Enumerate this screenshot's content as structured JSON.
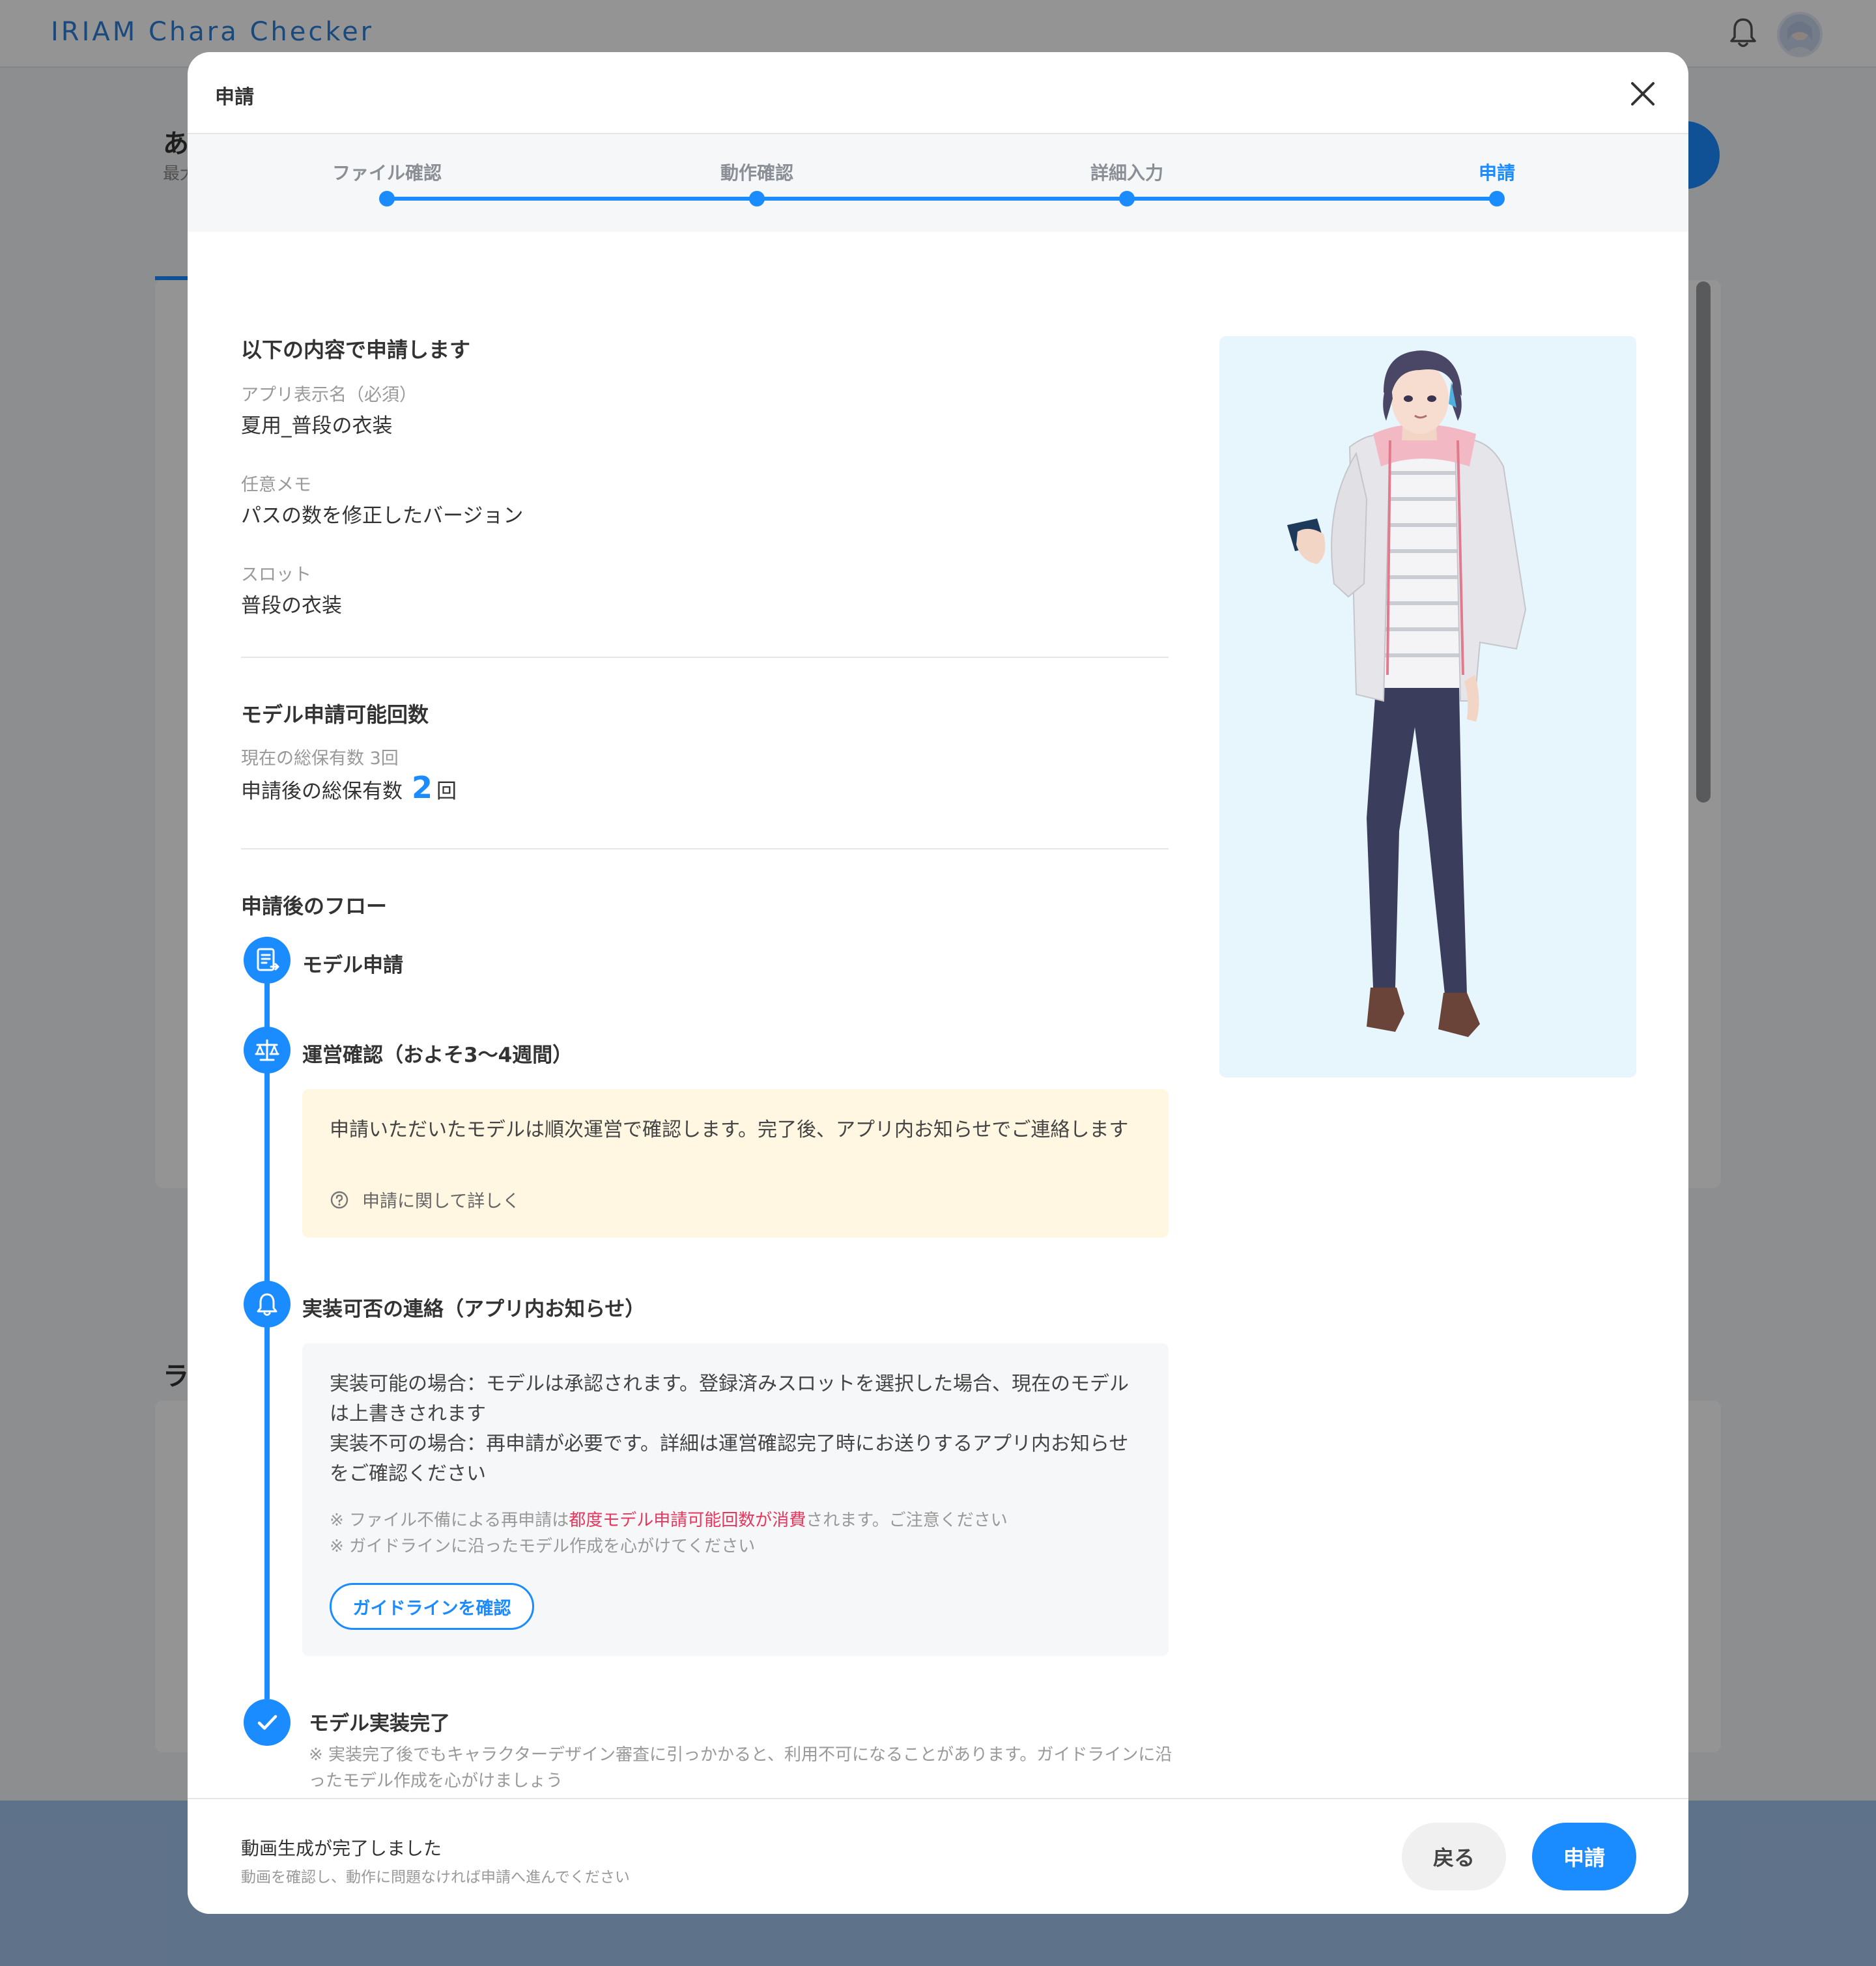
{
  "app": {
    "logo": "IRIAM Chara Checker",
    "bg_title_fragment": "あ",
    "bg_subtitle_fragment": "最大",
    "bg_section_fragment": "ラ"
  },
  "modal": {
    "title": "申請",
    "steps": [
      {
        "label": "ファイル確認",
        "active": false
      },
      {
        "label": "動作確認",
        "active": false
      },
      {
        "label": "詳細入力",
        "active": false
      },
      {
        "label": "申請",
        "active": true
      }
    ],
    "summary": {
      "heading": "以下の内容で申請します",
      "fields": [
        {
          "label": "アプリ表示名（必須）",
          "value": "夏用_普段の衣装"
        },
        {
          "label": "任意メモ",
          "value": "パスの数を修正したバージョン"
        },
        {
          "label": "スロット",
          "value": "普段の衣装"
        }
      ]
    },
    "quota": {
      "heading": "モデル申請可能回数",
      "current": "現在の総保有数 3回",
      "after_label": "申請後の総保有数",
      "after_count": "2",
      "after_unit": "回"
    },
    "flow": {
      "heading": "申請後のフロー",
      "steps": [
        {
          "icon": "document-icon",
          "title": "モデル申請"
        },
        {
          "icon": "scale-icon",
          "title": "運営確認（およそ3〜4週間）"
        },
        {
          "icon": "bell-icon",
          "title": "実装可否の連絡（アプリ内お知らせ）"
        },
        {
          "icon": "check-icon",
          "title": "モデル実装完了"
        }
      ],
      "review_note": "申請いただいたモデルは順次運営で確認します。完了後、アプリ内お知らせでご連絡します",
      "review_link": "申請に関して詳しく",
      "result_ok": "実装可能の場合：モデルは承認されます。登録済みスロットを選択した場合、現在のモデルは上書きされます",
      "result_ng": "実装不可の場合：再申請が必要です。詳細は運営確認完了時にお送りするアプリ内お知らせをご確認ください",
      "warn1_pre": "※ ファイル不備による再申請は",
      "warn1_red": "都度モデル申請可能回数が消費",
      "warn1_post": "されます。ご注意ください",
      "warn2": "※ ガイドラインに沿ったモデル作成を心がけてください",
      "guideline_button": "ガイドラインを確認",
      "final_note": "※ 実装完了後でもキャラクターデザイン審査に引っかかると、利用不可になることがあります。ガイドラインに沿ったモデル作成を心がけましょう"
    },
    "footer": {
      "status": "動画生成が完了しました",
      "hint": "動画を確認し、動作に問題なければ申請へ進んでください",
      "back_label": "戻る",
      "submit_label": "申請"
    }
  },
  "colors": {
    "accent": "#1a8cff",
    "warning_red": "#e8365c",
    "note_yellow": "#fff7e1",
    "character_panel": "#e7f5fd"
  }
}
